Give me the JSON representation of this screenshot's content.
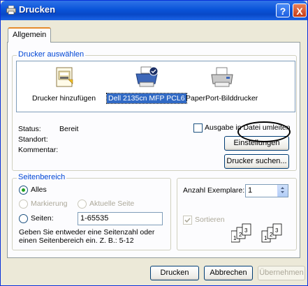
{
  "window": {
    "title": "Drucken"
  },
  "title_buttons": {
    "help": "?",
    "close": "X"
  },
  "tabs": [
    {
      "label": "Allgemein"
    }
  ],
  "printer_group": {
    "label": "Drucker auswählen",
    "printers": [
      {
        "label": "Drucker hinzufügen",
        "icon": "add-printer-icon"
      },
      {
        "label": "Dell 2135cn MFP PCL6",
        "icon": "printer-default-icon",
        "selected": true
      },
      {
        "label": "PaperPort-Bilddrucker",
        "icon": "printer-icon"
      }
    ],
    "status_label": "Status:",
    "status_value": "Bereit",
    "location_label": "Standort:",
    "comment_label": "Kommentar:",
    "print_to_file_label": "Ausgabe in Datei umleiten",
    "preferences_button": "Einstellungen",
    "find_printer_button": "Drucker suchen..."
  },
  "page_range": {
    "label": "Seitenbereich",
    "all_label": "Alles",
    "selection_label": "Markierung",
    "current_page_label": "Aktuelle Seite",
    "pages_label": "Seiten:",
    "pages_value": "1-65535",
    "help_text_line1": "Geben Sie entweder eine Seitenzahl oder",
    "help_text_line2": "einen Seitenbereich ein. Z. B.: 5-12"
  },
  "copies": {
    "label": "Anzahl Exemplare:",
    "value": "1",
    "collate_label": "Sortieren"
  },
  "buttons": {
    "print": "Drucken",
    "cancel": "Abbrechen",
    "apply": "Übernehmen"
  },
  "colors": {
    "accent": "#0046d5",
    "selection": "#316ac5",
    "titlebar": "#0a54d9"
  }
}
